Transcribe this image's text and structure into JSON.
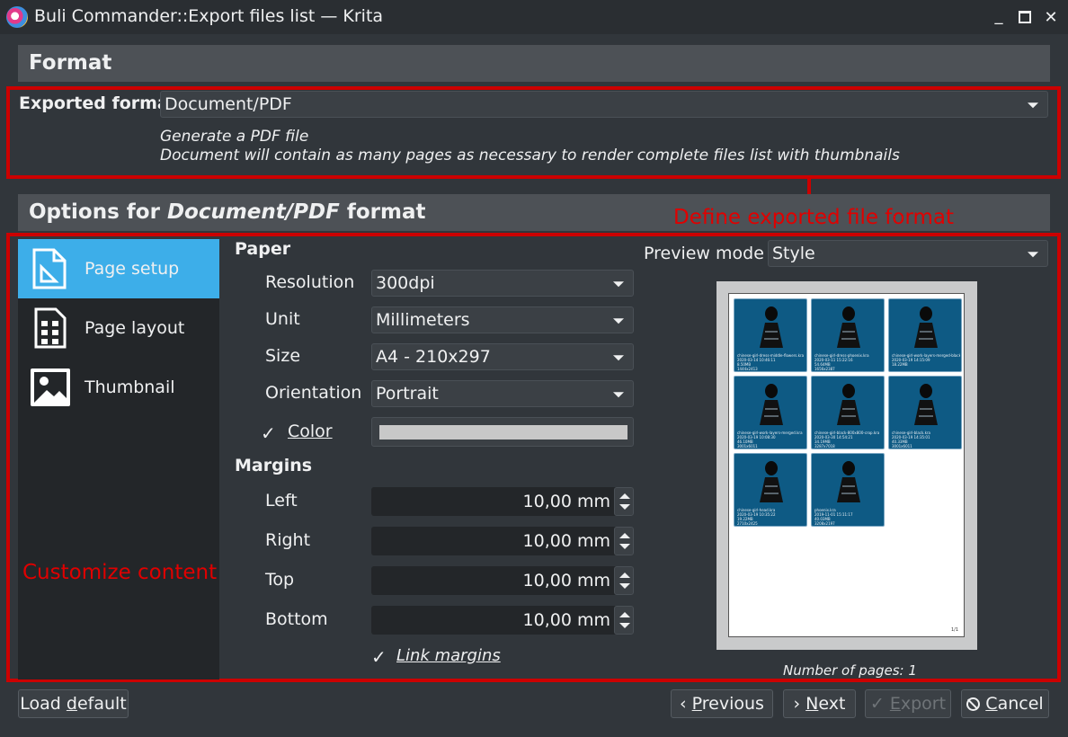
{
  "window": {
    "title": "Buli Commander::Export files list — Krita",
    "minimize_glyph": "_",
    "maximize_glyph": "☐",
    "close_glyph": "✕"
  },
  "format_section": {
    "title": "Format",
    "exported_format_label": "Exported format",
    "exported_format_value": "Document/PDF",
    "description_line1": "Generate a PDF file",
    "description_line2": "Document will contain as many pages as necessary to render complete files list with thumbnails"
  },
  "options_section": {
    "title_prefix": "Options for ",
    "title_format": "Document/PDF",
    "title_suffix": " format"
  },
  "annotations": {
    "format": "Define exported file format",
    "content": "Customize content",
    "color": "#cc0000"
  },
  "nav": {
    "items": [
      {
        "label": "Page setup",
        "icon": "page-setup-icon",
        "active": true
      },
      {
        "label": "Page layout",
        "icon": "page-layout-icon",
        "active": false
      },
      {
        "label": "Thumbnail",
        "icon": "thumbnail-icon",
        "active": false
      }
    ]
  },
  "paper": {
    "group_label": "Paper",
    "resolution_label": "Resolution",
    "resolution_value": "300dpi",
    "unit_label": "Unit",
    "unit_value": "Millimeters",
    "size_label": "Size",
    "size_value": "A4 - 210x297",
    "orientation_label": "Orientation",
    "orientation_value": "Portrait",
    "color_label": "Color",
    "color_checked": true,
    "color_swatch": "#c8c8c8"
  },
  "margins": {
    "group_label": "Margins",
    "left_label": "Left",
    "left_value": "10,00 mm",
    "right_label": "Right",
    "right_value": "10,00 mm",
    "top_label": "Top",
    "top_value": "10,00 mm",
    "bottom_label": "Bottom",
    "bottom_value": "10,00 mm",
    "link_label": "Link margins",
    "link_checked": true
  },
  "preview": {
    "mode_label": "Preview mode",
    "mode_value": "Style",
    "page_count": "Number of pages: 1",
    "page_number": "1/1",
    "thumbnails": [
      {
        "name": "chinese-girl-dress-middle-flowers.kra",
        "date": "2020-03-14 10:46:11",
        "size": "8.50MB",
        "dims": "1444x2413"
      },
      {
        "name": "chinese-girl-dress-phoenix.kra",
        "date": "2020-03-11 15:22:16",
        "size": "54.64MB",
        "dims": "1656x2387"
      },
      {
        "name": "chinese-girl-work-layers-merged-black_red.kra",
        "date": "2020-03-19 14:15:09",
        "size": "18.22MB",
        "dims": ""
      },
      {
        "name": "chinese-girl-work-layers-merged.kra",
        "date": "2020-03-19 10:08:30",
        "size": "46.10MB",
        "dims": "3001x6011"
      },
      {
        "name": "chinese-girl-black-800x800-crop.kra",
        "date": "2020-03-30 14:54:21",
        "size": "34.19MB",
        "dims": "3287x7018"
      },
      {
        "name": "chinese-girl-black.kra",
        "date": "2020-03-19 14:35:01",
        "size": "40.33MB",
        "dims": "3001x6011"
      },
      {
        "name": "chinese-girl-head.kra",
        "date": "2020-03-19 10:35:22",
        "size": "19.22MB",
        "dims": "2710x2425"
      },
      {
        "name": "phoenix.kra",
        "date": "2019-11-01 15:11:17",
        "size": "40.03MB",
        "dims": "3208x2197"
      }
    ]
  },
  "footer": {
    "load_default_pre": "Load ",
    "load_default_u": "d",
    "load_default_post": "efault",
    "previous_u": "P",
    "previous_post": "revious",
    "next_u": "N",
    "next_post": "ext",
    "export_u": "E",
    "export_post": "xport",
    "cancel_u": "C",
    "cancel_post": "ancel"
  }
}
